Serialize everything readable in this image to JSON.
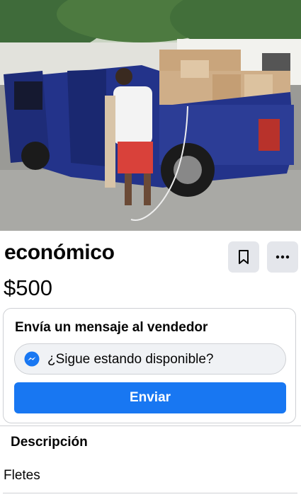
{
  "listing": {
    "title": "económico",
    "price": "$500"
  },
  "actions": {
    "save_icon": "bookmark-icon",
    "more_icon": "more-horizontal-icon"
  },
  "message": {
    "heading": "Envía un mensaje al vendedor",
    "input_value": "¿Sigue estando disponible?",
    "messenger_icon": "messenger-icon",
    "send_label": "Enviar"
  },
  "description": {
    "heading": "Descripción",
    "text": "Fletes"
  },
  "colors": {
    "accent": "#1877f2",
    "button_bg": "#e4e6eb"
  }
}
